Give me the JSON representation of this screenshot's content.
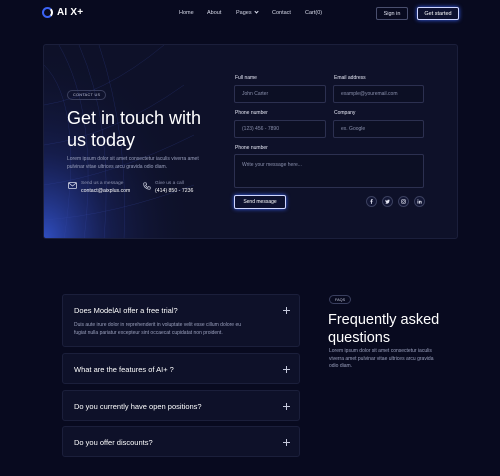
{
  "brand": {
    "name": "AI X+"
  },
  "nav": {
    "items": [
      "Home",
      "About",
      "Pages",
      "Contact",
      "Cart(0)"
    ],
    "signin": "Sign in",
    "get_started": "Get started"
  },
  "contact": {
    "tag": "CONTACT US",
    "headline": "Get in touch with us today",
    "description": "Lorem ipsum dolor sit amet consectetur iaculis viverra amet pulvinar vitae ultrices arcu gravida odio diam.",
    "email_label": "Send us a message",
    "email_value": "contact@aixplus.com",
    "phone_label": "Give us a call",
    "phone_value": "(414) 850 - 7236"
  },
  "form": {
    "full_name": {
      "label": "Full name",
      "placeholder": "John Carter"
    },
    "email": {
      "label": "Email address",
      "placeholder": "example@youremail.com"
    },
    "phone": {
      "label": "Phone number",
      "placeholder": "(123) 456 - 7890"
    },
    "company": {
      "label": "Company",
      "placeholder": "ex. Google"
    },
    "message": {
      "label": "Phone number",
      "placeholder": "Write your message here..."
    },
    "submit": "Send message"
  },
  "socials": [
    "facebook-icon",
    "twitter-icon",
    "instagram-icon",
    "linkedin-icon"
  ],
  "faq": {
    "tag": "FAQS",
    "title": "Frequently asked questions",
    "description": "Lorem ipsum dolor sit amet consectetur iaculis viverra amet pulvinar vitae ultrices arcu gravida odio diam.",
    "items": [
      {
        "question": "Does ModelAI offer a free trial?",
        "answer": "Duis aute irure dolor in reprehenderit in voluptate velit esse cillum dolore eu fugiat nulla pariatur excepteur sint occaecat cupidatat non proident."
      },
      {
        "question": "What are the features of AI+ ?"
      },
      {
        "question": "Do you currently have open positions?"
      },
      {
        "question": "Do you offer discounts?"
      }
    ]
  },
  "colors": {
    "background": "#080a1f",
    "card": "#0e1129",
    "accent": "#3b63f5"
  }
}
